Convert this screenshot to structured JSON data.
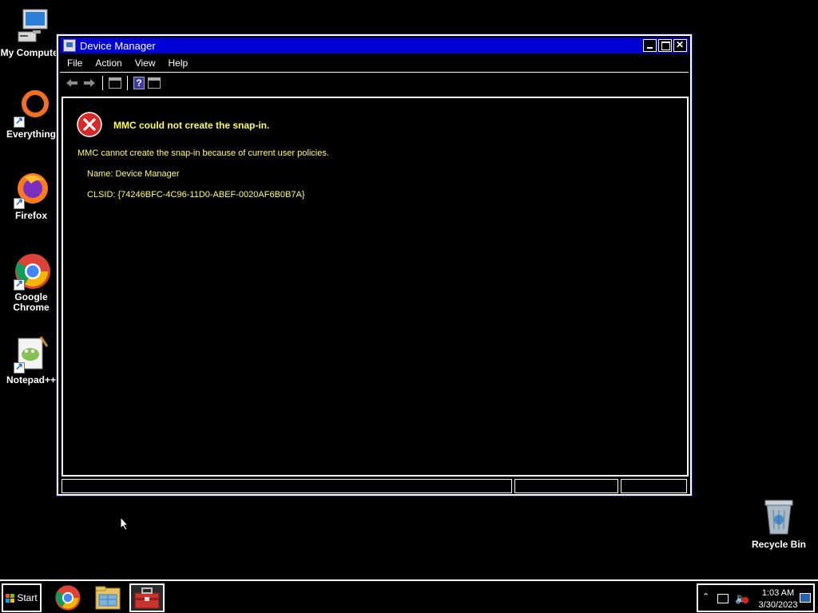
{
  "desktop": {
    "icons": [
      {
        "label": "My Computer",
        "icon": "computer-icon"
      },
      {
        "label": "Everything",
        "icon": "everything-search-icon"
      },
      {
        "label": "Firefox",
        "icon": "firefox-icon"
      },
      {
        "label": "Google Chrome",
        "icon": "chrome-icon"
      },
      {
        "label": "Notepad++",
        "icon": "notepadpp-icon"
      }
    ],
    "recycle_bin": {
      "label": "Recycle Bin",
      "icon": "recycle-bin-icon"
    }
  },
  "window": {
    "title": "Device Manager",
    "menu": [
      "File",
      "Action",
      "View",
      "Help"
    ],
    "toolbar": [
      "back-arrow-icon",
      "forward-arrow-icon",
      "console-tree-icon",
      "help-icon",
      "action-pane-icon"
    ],
    "error": {
      "title": "MMC could not create the snap-in.",
      "message": "MMC cannot create the snap-in because of current user policies.",
      "name_line": "Name: Device Manager",
      "clsid_line": "CLSID: {74246BFC-4C96-11D0-ABEF-0020AF6B0B7A}"
    }
  },
  "taskbar": {
    "start_label": "Start",
    "apps": [
      "chrome-icon",
      "file-explorer-icon",
      "toolbox-icon"
    ],
    "tray": {
      "time": "1:03 AM",
      "date": "3/30/2023"
    }
  },
  "colors": {
    "titlebar": "#0000d4",
    "error_text": "#ffff66",
    "error_icon": "#d42a2a"
  }
}
